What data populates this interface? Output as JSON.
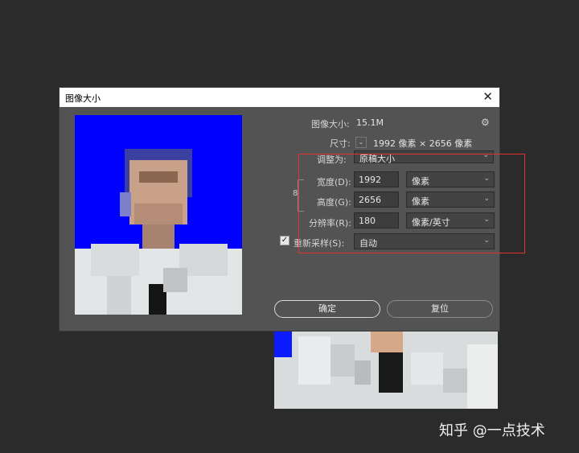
{
  "dialog": {
    "title": "图像大小",
    "close_symbol": "✕",
    "image_size_label": "图像大小:",
    "image_size_value": "15.1M",
    "dimensions_label": "尺寸:",
    "dimensions_value": "1992 像素 × 2656 像素",
    "fit_to_label": "调整为:",
    "fit_to_value": "原稿大小",
    "width_label": "宽度(D):",
    "width_value": "1992",
    "width_unit": "像素",
    "height_label": "高度(G):",
    "height_value": "2656",
    "height_unit": "像素",
    "resolution_label": "分辨率(R):",
    "resolution_value": "180",
    "resolution_unit": "像素/英寸",
    "resample_label": "重新采样(S):",
    "resample_checked": "✓",
    "resample_value": "自动",
    "ok_label": "确定",
    "reset_label": "复位"
  },
  "icons": {
    "gear": "⚙",
    "chevron_down": "⌄",
    "select_arrow": "⌄"
  },
  "watermark": "知乎 @一点技术",
  "colors": {
    "background": "#2b2b2b",
    "dialog": "#535353",
    "highlight": "#e0332f",
    "preview_bg": "#0000ff"
  }
}
